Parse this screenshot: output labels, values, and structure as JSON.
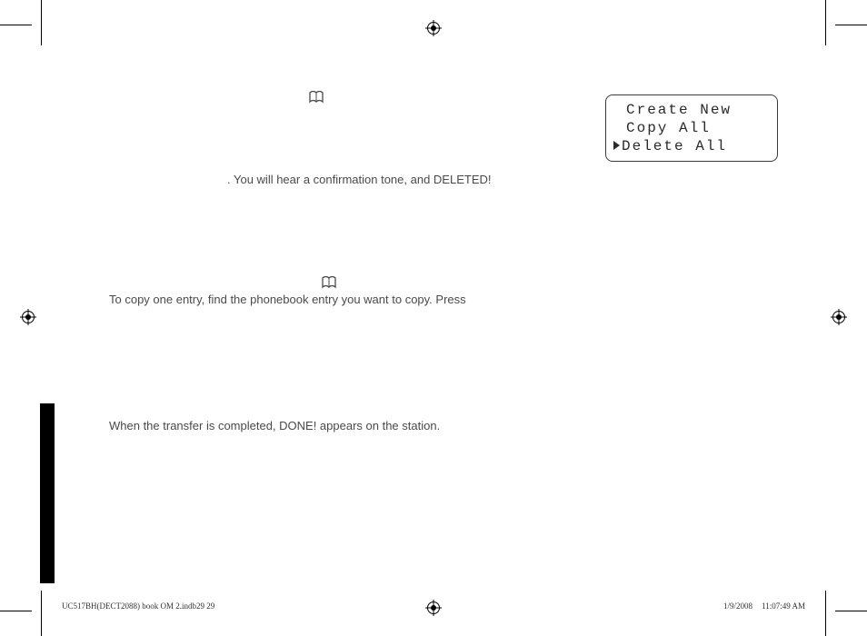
{
  "body": {
    "para1_suffix": ". You will hear a confirmation tone, and DELETED!",
    "para2": "To copy one entry, find the phonebook entry you want to copy. Press",
    "para3": "When the transfer is completed, DONE! appears on the station."
  },
  "lcd": {
    "line1": "Create New",
    "line2": "Copy All",
    "line3": "Delete All"
  },
  "footer": {
    "left": "UC517BH(DECT2088) book OM 2.indb29   29",
    "date": "1/9/2008",
    "time": "11:07:49 AM"
  }
}
